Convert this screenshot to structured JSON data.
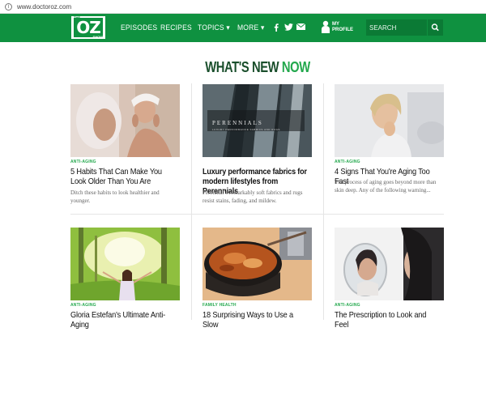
{
  "browser": {
    "url": "www.doctoroz.com"
  },
  "nav": {
    "logo": {
      "small_top": "THE",
      "main": "OZ",
      "small_bottom": "SHOW"
    },
    "items": [
      "EPISODES",
      "RECIPES",
      "TOPICS ▾",
      "MORE ▾"
    ],
    "social": [
      "f",
      "twitter",
      "mail"
    ],
    "profile_label": "MY\nPROFILE",
    "search_placeholder": "SEARCH"
  },
  "heading": {
    "part1": "WHAT'S NEW ",
    "part2": "NOW"
  },
  "cards": [
    {
      "category": "ANTI-AGING",
      "title": "5 Habits That Can Make You Look Older Than You Are",
      "description": "Ditch these habits to look healthier and younger."
    },
    {
      "category": "",
      "title": "Luxury performance fabrics for modern lifestyles from Perennials",
      "description": "Perennial’s remarkably soft fabrics and rugs resist stains, fading, and mildew.",
      "image_text": "PERENNIALS",
      "image_subtext": "LUXURY PERFORMANCE FABRICS AND RUGS"
    },
    {
      "category": "ANTI-AGING",
      "title": "4 Signs That You're Aging Too Fast",
      "description": "The process of aging goes beyond more than skin deep. Any of the following warning..."
    },
    {
      "category": "ANTI-AGING",
      "title": "Gloria Estefan's Ultimate Anti-Aging",
      "description": ""
    },
    {
      "category": "FAMILY HEALTH",
      "title": "18 Surprising Ways to Use a Slow",
      "description": ""
    },
    {
      "category": "ANTI-AGING",
      "title": "The Prescription to Look and Feel",
      "description": ""
    }
  ],
  "colors": {
    "brand_green": "#0f9140",
    "accent_green": "#23a84d",
    "heading_dark": "#1a4f2c"
  }
}
